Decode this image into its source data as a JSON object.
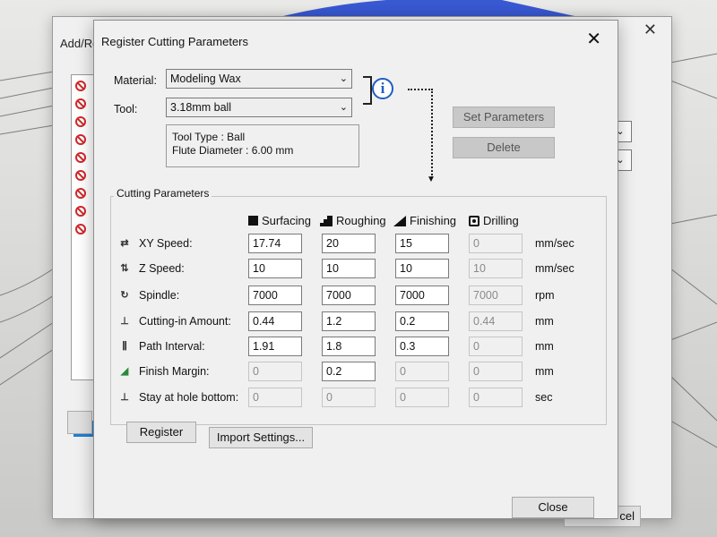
{
  "behind_dialog": {
    "title": "Add/Re",
    "close_glyph": "✕",
    "cancel_fragment": "cel",
    "list_error_count": 9
  },
  "dialog": {
    "title": "Register Cutting Parameters",
    "close_glyph": "✕",
    "material": {
      "label": "Material:",
      "value": "Modeling Wax"
    },
    "tool": {
      "label": "Tool:",
      "value": "3.18mm ball"
    },
    "info_glyph": "i",
    "tool_info": {
      "tool_type": "Tool Type : Ball",
      "flute_diameter": "Flute Diameter : 6.00 mm"
    },
    "buttons": {
      "set_parameters": "Set Parameters",
      "delete": "Delete",
      "register": "Register",
      "import_settings": "Import Settings...",
      "close": "Close"
    },
    "group_title": "Cutting Parameters",
    "columns": [
      {
        "key": "surfacing",
        "label": "Surfacing",
        "icon": "surfacing-icon"
      },
      {
        "key": "roughing",
        "label": "Roughing",
        "icon": "roughing-icon"
      },
      {
        "key": "finishing",
        "label": "Finishing",
        "icon": "finishing-icon"
      },
      {
        "key": "drilling",
        "label": "Drilling",
        "icon": "drilling-icon"
      }
    ],
    "rows": [
      {
        "label": "XY Speed:",
        "unit": "mm/sec",
        "icon": "xy-speed-icon",
        "values": [
          "17.74",
          "20",
          "15",
          "0"
        ],
        "enabled": [
          true,
          true,
          true,
          false
        ]
      },
      {
        "label": "Z Speed:",
        "unit": "mm/sec",
        "icon": "z-speed-icon",
        "values": [
          "10",
          "10",
          "10",
          "10"
        ],
        "enabled": [
          true,
          true,
          true,
          false
        ]
      },
      {
        "label": "Spindle:",
        "unit": "rpm",
        "icon": "spindle-icon",
        "values": [
          "7000",
          "7000",
          "7000",
          "7000"
        ],
        "enabled": [
          true,
          true,
          true,
          false
        ]
      },
      {
        "label": "Cutting-in Amount:",
        "unit": "mm",
        "icon": "cutting-in-icon",
        "values": [
          "0.44",
          "1.2",
          "0.2",
          "0.44"
        ],
        "enabled": [
          true,
          true,
          true,
          false
        ]
      },
      {
        "label": "Path Interval:",
        "unit": "mm",
        "icon": "path-interval-icon",
        "values": [
          "1.91",
          "1.8",
          "0.3",
          "0"
        ],
        "enabled": [
          true,
          true,
          true,
          false
        ]
      },
      {
        "label": "Finish Margin:",
        "unit": "mm",
        "icon": "finish-margin-icon",
        "values": [
          "0",
          "0.2",
          "0",
          "0"
        ],
        "enabled": [
          false,
          true,
          false,
          false
        ]
      },
      {
        "label": "Stay at hole bottom:",
        "unit": "sec",
        "icon": "stay-hole-icon",
        "values": [
          "0",
          "0",
          "0",
          "0"
        ],
        "enabled": [
          false,
          false,
          false,
          false
        ]
      }
    ]
  }
}
